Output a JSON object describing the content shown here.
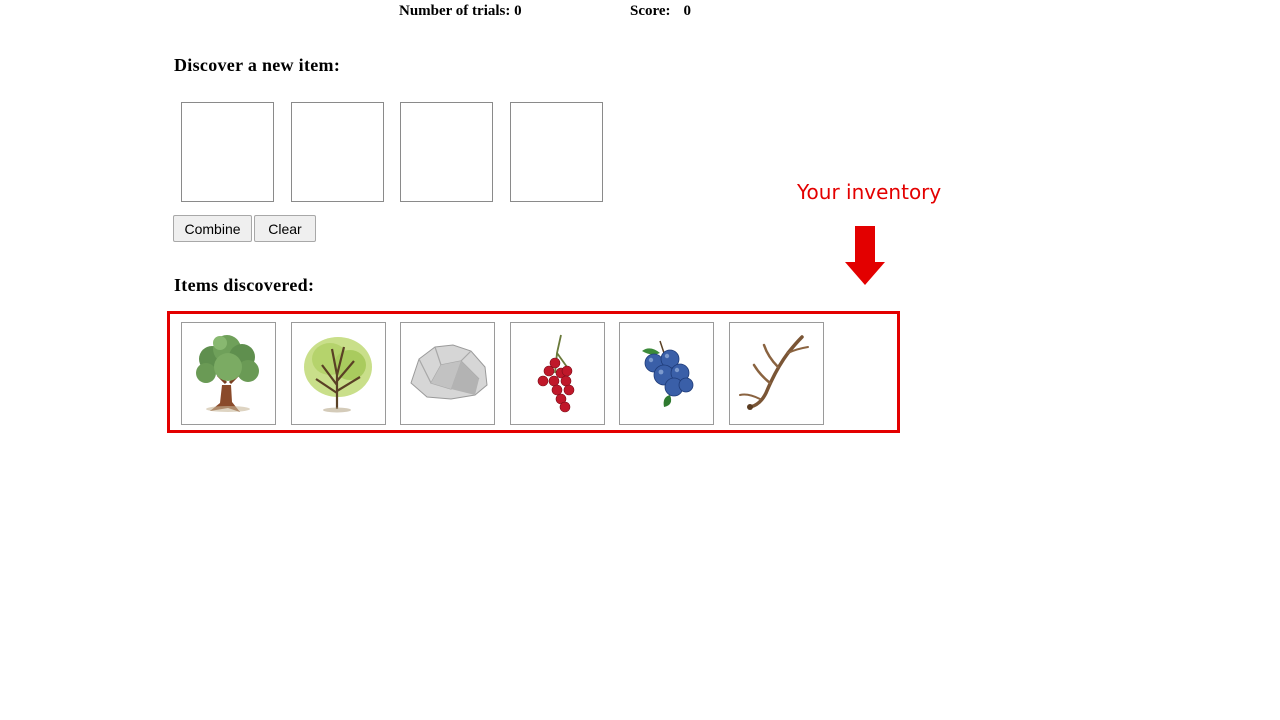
{
  "stats": {
    "trials_label": "Number of trials:",
    "trials_value": "0",
    "score_label": "Score:",
    "score_value": "0"
  },
  "discover": {
    "heading": "Discover a new item:",
    "slots_count": 4
  },
  "buttons": {
    "combine": "Combine",
    "clear": "Clear"
  },
  "items_discovered": {
    "heading": "Items discovered:",
    "items": [
      {
        "icon": "oak-tree-icon"
      },
      {
        "icon": "leafy-tree-icon"
      },
      {
        "icon": "rock-icon"
      },
      {
        "icon": "red-berries-icon"
      },
      {
        "icon": "blueberries-icon"
      },
      {
        "icon": "antler-icon"
      }
    ]
  },
  "annotation": {
    "text": "Your inventory",
    "color": "#e30000"
  }
}
